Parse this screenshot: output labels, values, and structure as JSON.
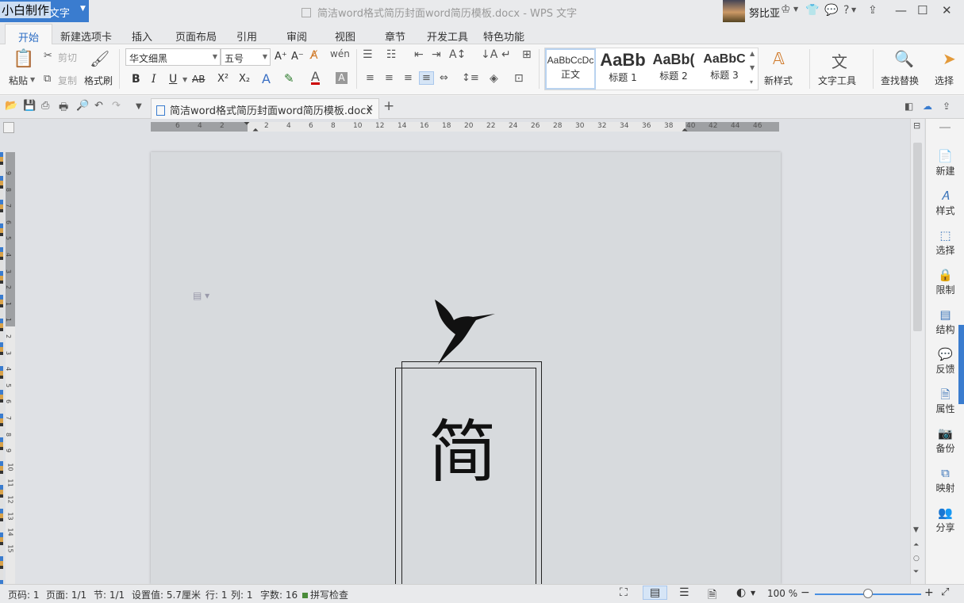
{
  "titlebar": {
    "app_name": "文字",
    "watermark": "小白制作",
    "doc_title": "简洁word格式简历封面word简历模板.docx - WPS 文字",
    "username": "努比亚",
    "help_label": "?",
    "minimize": "—",
    "restore": "☐",
    "close": "✕"
  },
  "tabs": [
    "开始",
    "新建选项卡",
    "插入",
    "页面布局",
    "引用",
    "审阅",
    "视图",
    "章节",
    "开发工具",
    "特色功能"
  ],
  "ribbon": {
    "paste": "粘贴",
    "cut": "剪切",
    "copy": "复制",
    "format_painter": "格式刷",
    "font_name": "华文细黑",
    "font_size": "五号",
    "bold": "B",
    "italic": "I",
    "underline": "U",
    "strikethrough": "AB",
    "superscript": "X²",
    "subscript": "X₂",
    "grow": "A⁺",
    "shrink": "A⁻",
    "styles": [
      {
        "sample": "AaBbCcDc",
        "label": "正文"
      },
      {
        "sample": "AaBb",
        "label": "标题 1"
      },
      {
        "sample": "AaBb(",
        "label": "标题 2"
      },
      {
        "sample": "AaBbC",
        "label": "标题 3"
      }
    ],
    "new_style": "新样式",
    "text_tools": "文字工具",
    "find_replace": "查找替换",
    "select": "选择"
  },
  "doc_tab": {
    "name": "简洁word格式简历封面word简历模板.docx",
    "close": "×",
    "new_tab": "+"
  },
  "ruler": {
    "h_ticks": [
      "6",
      "4",
      "2",
      "2",
      "4",
      "6",
      "8",
      "10",
      "12",
      "14",
      "16",
      "18",
      "20",
      "22",
      "24",
      "26",
      "28",
      "30",
      "32",
      "34",
      "36",
      "38",
      "40",
      "42",
      "44",
      "46"
    ],
    "v_ticks": [
      "9",
      "8",
      "7",
      "6",
      "5",
      "4",
      "3",
      "2",
      "1",
      "1",
      "2",
      "3",
      "4",
      "5",
      "6",
      "7",
      "8",
      "9",
      "10",
      "11",
      "12",
      "13",
      "14",
      "15"
    ]
  },
  "page": {
    "big_char": "简"
  },
  "taskpane": [
    "新建",
    "样式",
    "选择",
    "限制",
    "结构",
    "反馈",
    "属性",
    "备份",
    "映射",
    "分享"
  ],
  "statusbar": {
    "page_num": "页码: 1",
    "pages": "页面: 1/1",
    "section": "节: 1/1",
    "setting": "设置值: 5.7厘米",
    "row": "行: 1",
    "col": "列: 1",
    "word_count": "字数: 16",
    "spell_check": "拼写检查",
    "zoom": "100 %",
    "zoom_level": 1.0
  },
  "colors": {
    "accent": "#3a7ccf",
    "tab_active_text": "#2b6cc4",
    "workspace_bg": "#dfe1e5",
    "page_bg": "#d7dadd"
  }
}
